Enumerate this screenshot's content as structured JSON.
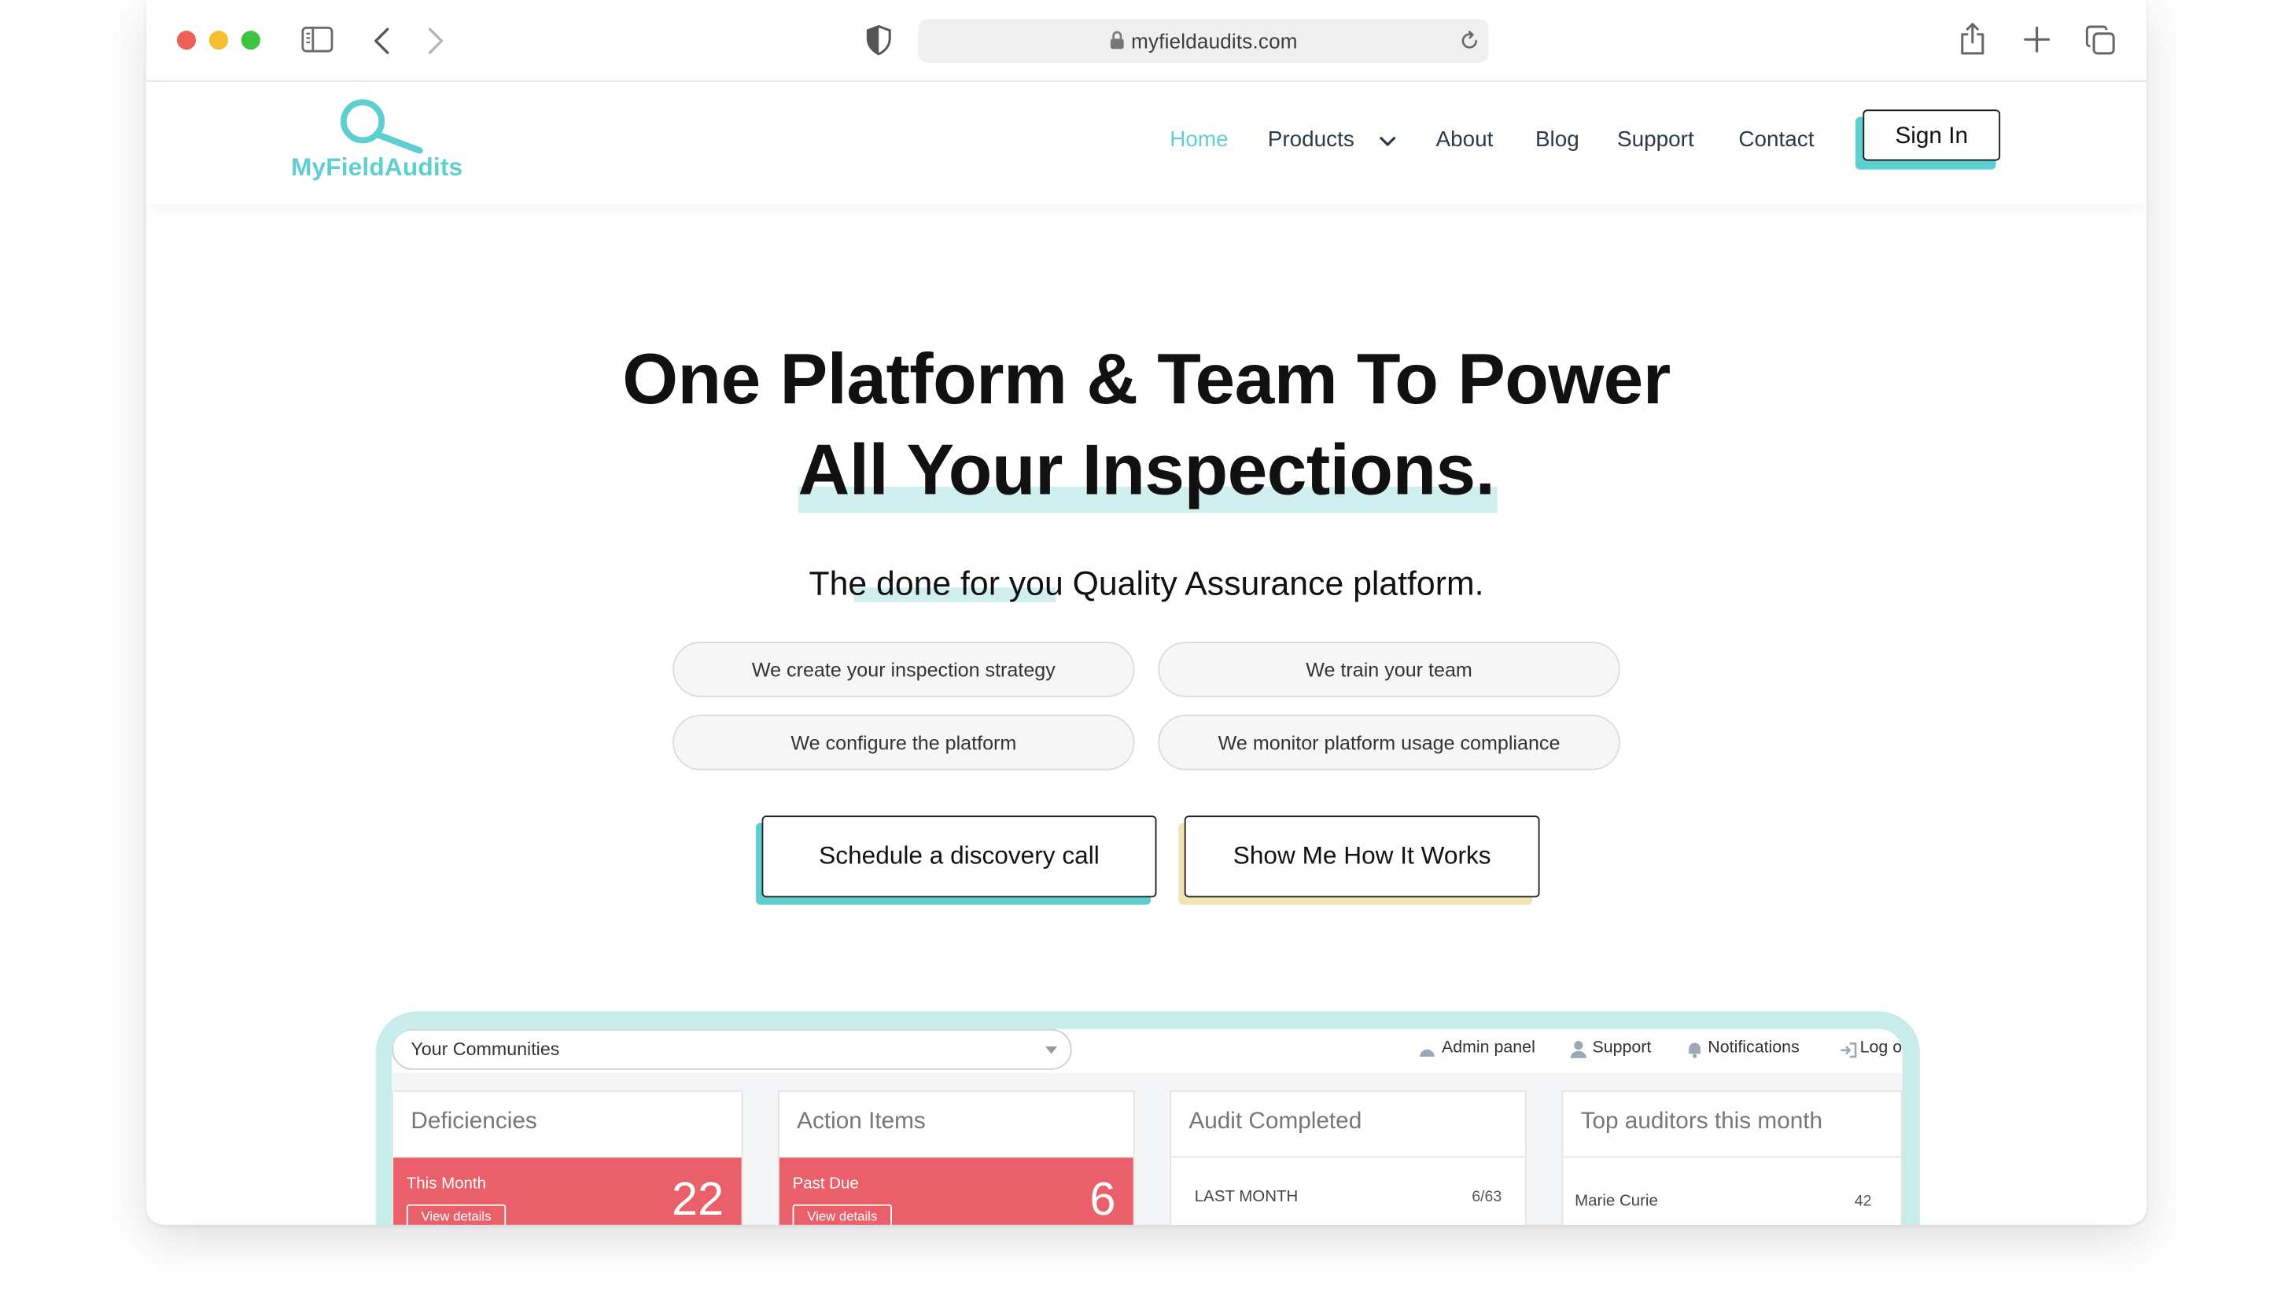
{
  "browser": {
    "url": "myfieldaudits.com"
  },
  "site": {
    "logo_text": "MyFieldAudits",
    "nav": {
      "home": "Home",
      "products": "Products",
      "about": "About",
      "blog": "Blog",
      "support": "Support",
      "contact": "Contact"
    },
    "sign_in": "Sign In",
    "accent_color": "#5ecfd0"
  },
  "hero": {
    "title_line1": "One Platform & Team To Power",
    "title_line2": "All Your Inspections.",
    "subtitle_pre": "The ",
    "subtitle_highlight": "done for you",
    "subtitle_post": " Quality Assurance platform.",
    "chips": [
      "We create your inspection strategy",
      "We train your team",
      "We configure the platform",
      "We monitor platform usage compliance"
    ],
    "cta_primary": "Schedule a discovery call",
    "cta_secondary": "Show Me How It Works"
  },
  "dashboard": {
    "community_select": "Your Communities",
    "top_nav": {
      "admin": "Admin panel",
      "support": "Support",
      "notifications": "Notifications",
      "logout": "Log o"
    },
    "cards": {
      "deficiencies": {
        "title": "Deficiencies",
        "label": "This Month",
        "value": "22",
        "button": "View details"
      },
      "action_items": {
        "title": "Action Items",
        "label": "Past Due",
        "value": "6",
        "button": "View details"
      },
      "audit_completed": {
        "title": "Audit Completed",
        "row_label": "LAST MONTH",
        "row_value": "6/63"
      },
      "top_auditors": {
        "title": "Top auditors this month",
        "row_name": "Marie Curie",
        "row_value": "42"
      }
    }
  }
}
